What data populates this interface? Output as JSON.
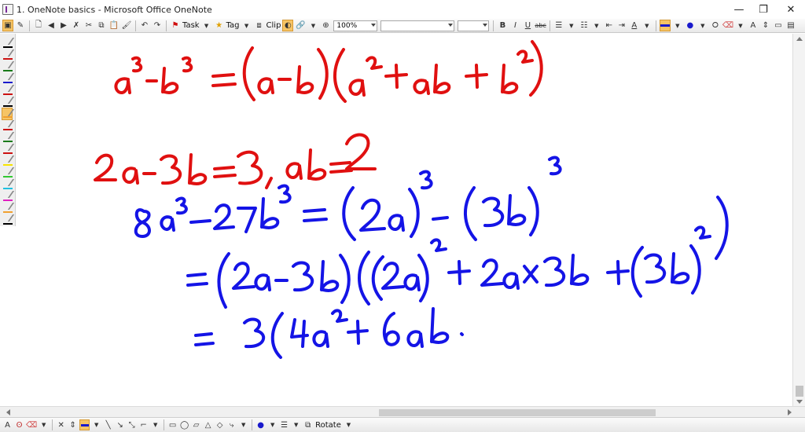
{
  "window": {
    "title": "1. OneNote basics - Microsoft Office OneNote",
    "min_glyph": "—",
    "max_glyph": "❐",
    "close_glyph": "✕"
  },
  "toolbar": {
    "task_label": "Task",
    "tag_label": "Tag",
    "clip_label": "Clip",
    "zoom_value": "100%",
    "font_value": "",
    "size_value": "",
    "bold": "B",
    "italic": "I",
    "underline": "U",
    "strike": "abc",
    "font_color_letter": "A",
    "ink_to_text": "A"
  },
  "drawbar": {
    "select_text": "A",
    "rotate_label": "Rotate"
  },
  "pens": [
    {
      "color": "#000000"
    },
    {
      "color": "#cc1111"
    },
    {
      "color": "#1a7a1a"
    },
    {
      "color": "#1a1acc"
    },
    {
      "color": "#cc1111"
    },
    {
      "color": "#000000"
    },
    {
      "color": "#f0a030",
      "active": true
    },
    {
      "color": "#cc1111"
    },
    {
      "color": "#1a7a1a"
    },
    {
      "color": "#cc1111"
    },
    {
      "color": "#f7e400"
    },
    {
      "color": "#32c832"
    },
    {
      "color": "#20c0e0"
    },
    {
      "color": "#e020c0"
    },
    {
      "color": "#f0a030"
    },
    {
      "color": "#000000"
    }
  ],
  "colors": {
    "ink_red": "#e01010",
    "ink_blue": "#1414e6",
    "highlight": "#f6c465"
  },
  "icons": {
    "cursor": "cursor-icon",
    "pen": "pen-icon",
    "eraser": "eraser-icon",
    "lasso": "lasso-icon",
    "rotate": "rotate-icon"
  }
}
